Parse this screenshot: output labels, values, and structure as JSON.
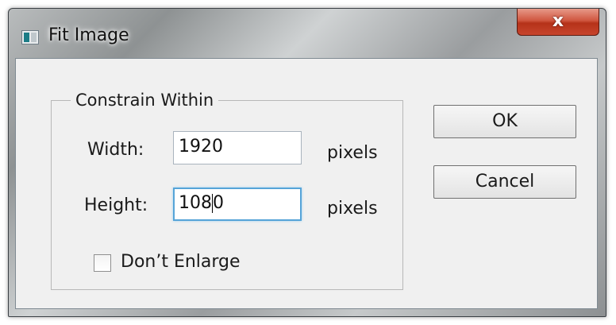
{
  "window": {
    "title": "Fit Image",
    "close_glyph": "x",
    "icon": "photoshop-app-icon"
  },
  "group": {
    "legend": "Constrain Within"
  },
  "width": {
    "label": "Width:",
    "value": "1920",
    "unit": "pixels"
  },
  "height": {
    "label": "Height:",
    "value_before_caret": "108",
    "value_after_caret": "0",
    "unit": "pixels"
  },
  "dont_enlarge": {
    "label": "Don’t Enlarge",
    "checked": false
  },
  "buttons": {
    "ok": "OK",
    "cancel": "Cancel"
  }
}
